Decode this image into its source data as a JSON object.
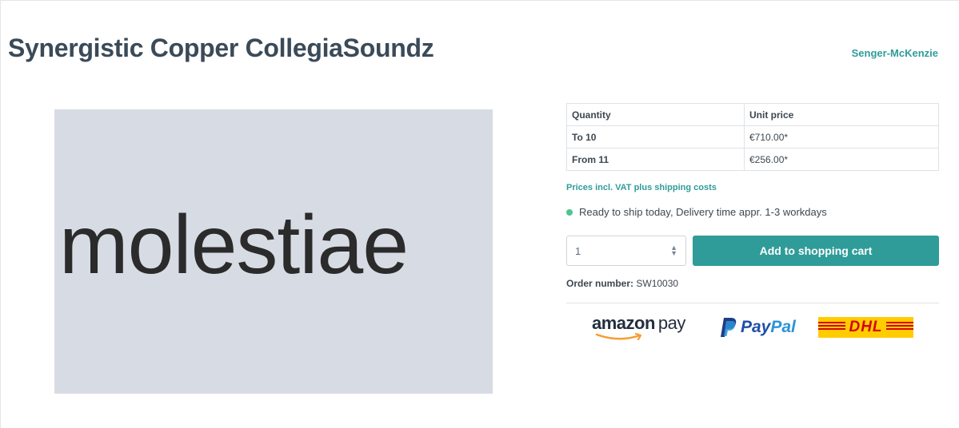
{
  "product": {
    "title": "Synergistic Copper CollegiaSoundz",
    "manufacturer": "Senger-McKenzie",
    "image_text": "molestiae"
  },
  "price_table": {
    "headers": [
      "Quantity",
      "Unit price"
    ],
    "rows": [
      {
        "quantity": "To 10",
        "price": "€710.00*"
      },
      {
        "quantity": "From 11",
        "price": "€256.00*"
      }
    ]
  },
  "vat_note": "Prices incl. VAT plus shipping costs",
  "delivery": {
    "text": "Ready to ship today, Delivery time appr. 1-3 workdays",
    "status_color": "#4ec58f"
  },
  "buy": {
    "quantity_value": "1",
    "add_to_cart_label": "Add to shopping cart"
  },
  "order": {
    "label": "Order number:",
    "value": "SW10030"
  },
  "payment_logos": {
    "amazon_word": "amazon",
    "amazon_pay": "pay",
    "paypal_pay": "Pay",
    "paypal_pal": "Pal",
    "dhl": "DHL"
  },
  "colors": {
    "accent": "#2f9c99",
    "title": "#3a4a58",
    "image_bg": "#d7dce4"
  }
}
